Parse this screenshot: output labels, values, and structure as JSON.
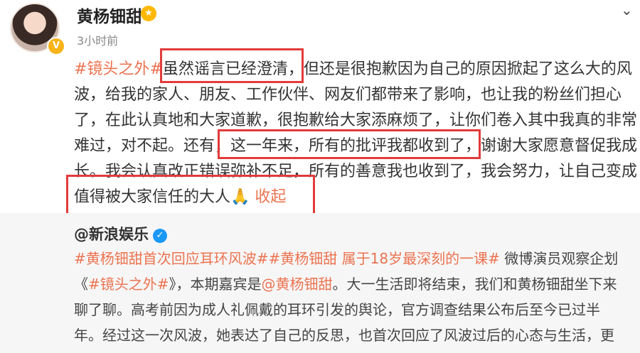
{
  "post": {
    "author": "黄杨钿甜",
    "time": "3小时前",
    "lines": [
      [
        {
          "t": "#镜头之外#",
          "c": "tag"
        },
        {
          "t": "虽然谣言已经澄清，"
        },
        {
          "t": "但还是很抱歉因为自己的原因掀起了这么大的风"
        }
      ],
      [
        {
          "t": "波，给我的家人、朋友、工作伙伴、网友们都带来了影响，也让我的粉丝们担心"
        }
      ],
      [
        {
          "t": "了，在此认真地和大家道歉，很抱歉给大家添麻烦了，让你们卷入其中我真的非常"
        }
      ],
      [
        {
          "t": "难过，对不起。还有，"
        },
        {
          "t": "这一年来，所有的批评我都收到了，"
        },
        {
          "t": "谢谢大家愿意督促我成"
        }
      ],
      [
        {
          "t": "长。我会认真改正错误弥补不足，所有的善意我也收到了，我会努力，让自己变成"
        }
      ],
      [
        {
          "t": "值得被大家信任的大人🙏 "
        },
        {
          "t": "收起",
          "c": "link"
        }
      ]
    ]
  },
  "repost": {
    "author": "@新浪娱乐",
    "lines": [
      [
        {
          "t": "#黄杨钿甜首次回应耳环风波##黄杨钿甜 属于18岁最深刻的一课#",
          "c": "tag"
        },
        {
          "t": " 微博演员观察企划"
        }
      ],
      [
        {
          "t": "《"
        },
        {
          "t": "#镜头之外#",
          "c": "tag"
        },
        {
          "t": "》，本期嘉宾是"
        },
        {
          "t": "@黄杨钿甜",
          "c": "link"
        },
        {
          "t": "。大一生活即将结束，我们和黄杨钿甜坐下来"
        }
      ],
      [
        {
          "t": "聊了聊。高考前因为成人礼佩戴的耳环引发的舆论，官方调查结果公布后至今已过半"
        }
      ],
      [
        {
          "t": "年。经过这一次风波，她表达了自己的反思，也首次回应了风波过后的心态与生活，更"
        }
      ]
    ]
  },
  "icons": {
    "chevron": "chevron-down-icon",
    "verified": "verified-icon",
    "badge": "fan-badge-icon"
  }
}
